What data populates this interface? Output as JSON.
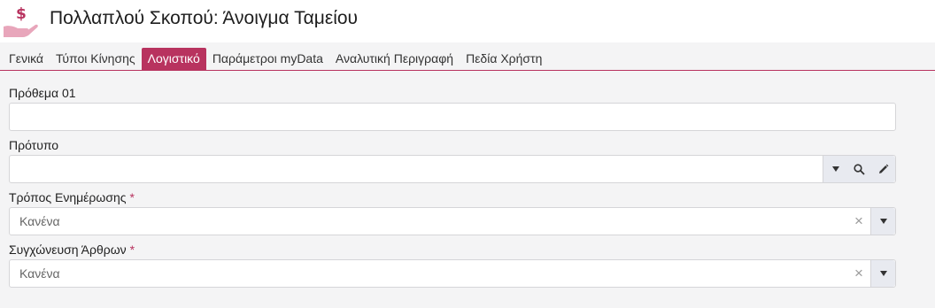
{
  "header": {
    "title": "Πολλαπλού Σκοπού: Άνοιγμα Ταμείου",
    "logo_icon": "money-hand-icon",
    "accent_color": "#b8335f"
  },
  "tabs": [
    {
      "label": "Γενικά",
      "active": false
    },
    {
      "label": "Τύποι Κίνησης",
      "active": false
    },
    {
      "label": "Λογιστικό",
      "active": true
    },
    {
      "label": "Παράμετροι myData",
      "active": false
    },
    {
      "label": "Αναλυτική Περιγραφή",
      "active": false
    },
    {
      "label": "Πεδία Χρήστη",
      "active": false
    }
  ],
  "fields": {
    "prefix": {
      "label": "Πρόθεμα 01",
      "value": ""
    },
    "template": {
      "label": "Πρότυπο",
      "value": ""
    },
    "update_mode": {
      "label": "Τρόπος Ενημέρωσης",
      "required_mark": "*",
      "value": "Κανένα",
      "clear_icon": "×"
    },
    "merge_entries": {
      "label": "Συγχώνευση Άρθρων",
      "required_mark": "*",
      "value": "Κανένα",
      "clear_icon": "×"
    }
  }
}
